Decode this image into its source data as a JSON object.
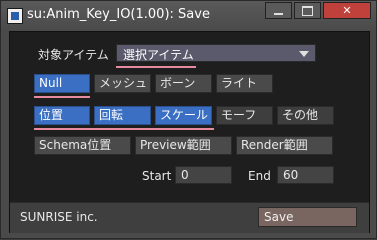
{
  "window": {
    "title": "su:Anim_Key_IO(1.00): Save",
    "minimize_icon": "minimize-icon",
    "maximize_icon": "maximize-icon",
    "close_icon": "close-icon",
    "close_label": "✕"
  },
  "target": {
    "label": "対象アイテム",
    "selected": "選択アイテム",
    "accent_color": "#e88aa0"
  },
  "type_row": [
    {
      "label": "Null",
      "active": true
    },
    {
      "label": "メッシュ",
      "active": false
    },
    {
      "label": "ボーン",
      "active": false
    },
    {
      "label": "ライト",
      "active": false
    }
  ],
  "channel_row": [
    {
      "label": "位置",
      "active": true
    },
    {
      "label": "回転",
      "active": true
    },
    {
      "label": "スケール",
      "active": true
    },
    {
      "label": "モーフ",
      "active": false
    },
    {
      "label": "その他",
      "active": false
    }
  ],
  "range_row": [
    {
      "label": "Schema位置"
    },
    {
      "label": "Preview範囲"
    },
    {
      "label": "Render範囲"
    }
  ],
  "frames": {
    "start_label": "Start",
    "start_value": "0",
    "end_label": "End",
    "end_value": "60"
  },
  "footer": {
    "brand": "SUNRISE inc.",
    "save_label": "Save"
  },
  "colors": {
    "active_button": "#3a6fc4",
    "save_button": "#7a6661",
    "close_button": "#c0413b"
  }
}
